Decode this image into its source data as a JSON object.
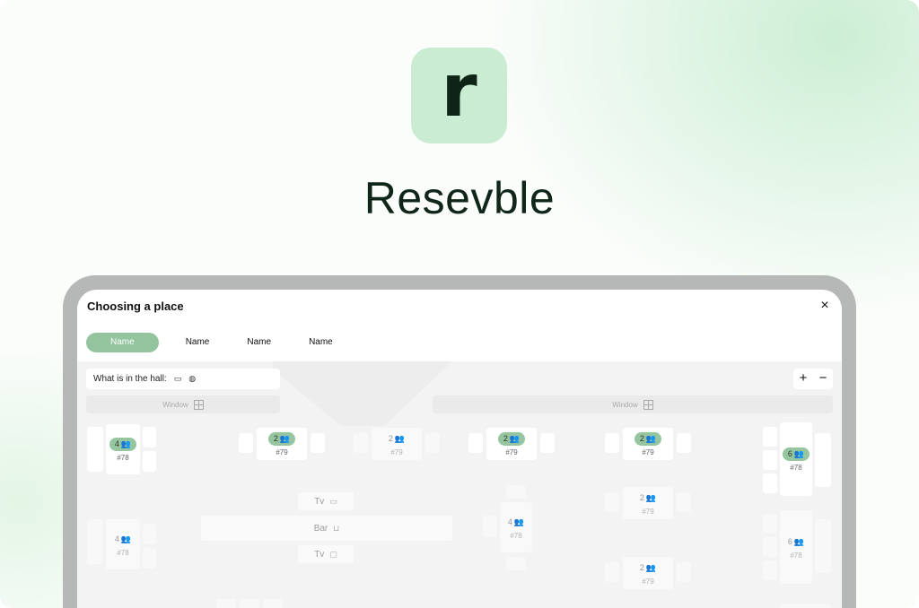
{
  "brand": {
    "name": "Resevble",
    "logo_letter": "r",
    "logo_bg": "#c9ecd3",
    "accent": "#95c6a0"
  },
  "modal": {
    "title": "Choosing a place",
    "close_icon": "×",
    "tabs": [
      {
        "label": "Name",
        "active": true
      },
      {
        "label": "Name",
        "active": false
      },
      {
        "label": "Name",
        "active": false
      },
      {
        "label": "Name",
        "active": false
      }
    ]
  },
  "hall": {
    "info_label": "What is in the hall:",
    "info_icons": [
      "sofa-icon",
      "globe-icon"
    ],
    "zoom_in": "+",
    "zoom_out": "−",
    "window_label": "Window",
    "zones": [
      {
        "label": "Tv",
        "icon": "tv-icon"
      },
      {
        "label": "Bar",
        "icon": "glass-icon"
      },
      {
        "label": "Tv",
        "icon": "chat-icon"
      }
    ],
    "tables": [
      {
        "seats": "4",
        "num": "#78",
        "available": true
      },
      {
        "seats": "2",
        "num": "#79",
        "available": true
      },
      {
        "seats": "2",
        "num": "#79",
        "available": false
      },
      {
        "seats": "2",
        "num": "#79",
        "available": true
      },
      {
        "seats": "2",
        "num": "#79",
        "available": true
      },
      {
        "seats": "6",
        "num": "#78",
        "available": true
      },
      {
        "seats": "2",
        "num": "#79",
        "available": false
      },
      {
        "seats": "4",
        "num": "#78",
        "available": false
      },
      {
        "seats": "4",
        "num": "#78",
        "available": false
      },
      {
        "seats": "6",
        "num": "#78",
        "available": false
      },
      {
        "seats": "2",
        "num": "#79",
        "available": false
      }
    ]
  }
}
